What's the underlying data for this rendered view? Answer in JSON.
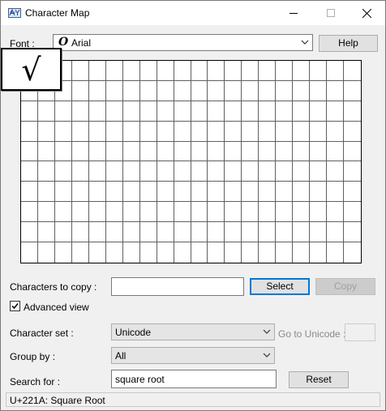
{
  "window": {
    "title": "Character Map"
  },
  "font_row": {
    "label": "Font :",
    "selected": "Arial",
    "font_type_glyph": "O",
    "help_label": "Help"
  },
  "zoom_char": "√",
  "copy_row": {
    "label": "Characters to copy :",
    "value": "",
    "select_label": "Select",
    "copy_label": "Copy"
  },
  "advanced": {
    "label": "Advanced view",
    "checked": true
  },
  "charset_row": {
    "label": "Character set :",
    "selected": "Unicode",
    "goto_label": "Go to Unicode :",
    "goto_value": ""
  },
  "groupby_row": {
    "label": "Group by :",
    "selected": "All"
  },
  "search_row": {
    "label": "Search for :",
    "value": "square root",
    "reset_label": "Reset"
  },
  "status": {
    "text": "U+221A: Square Root"
  }
}
